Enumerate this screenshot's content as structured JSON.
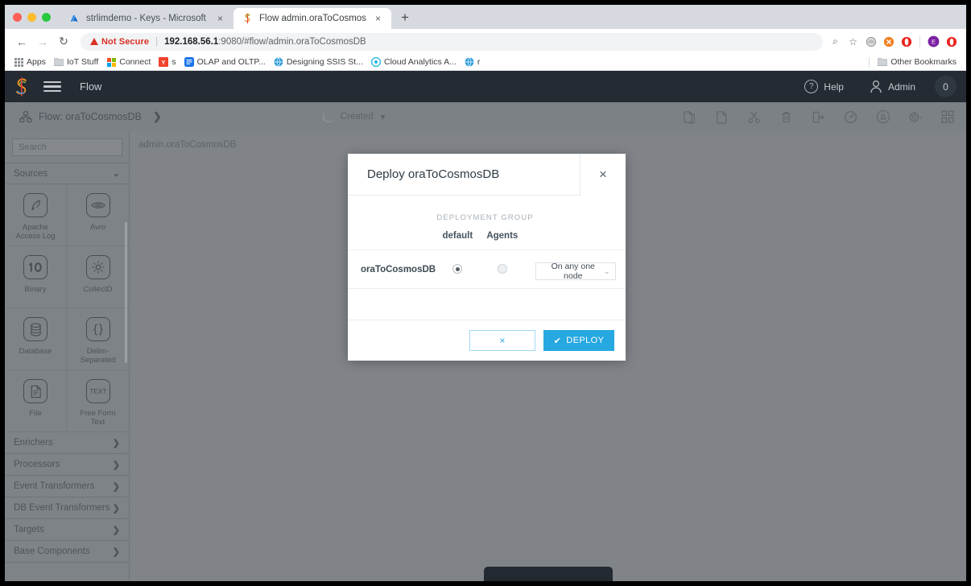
{
  "browser": {
    "tabs": [
      {
        "title": "strlimdemo - Keys - Microsoft",
        "favicon": "azure-icon",
        "close": "×",
        "active": false
      },
      {
        "title": "Flow admin.oraToCosmosDB",
        "favicon": "striim-icon",
        "close": "×",
        "active": true
      }
    ],
    "new_tab_label": "+",
    "nav": {
      "back": "←",
      "forward": "→",
      "reload": "↻"
    },
    "address": {
      "security_label": "Not Secure",
      "host": "192.168.56.1",
      "rest": ":9080/#flow/admin.oraToCosmosDB"
    },
    "omni_icons": [
      {
        "name": "zoom-icon",
        "glyph": "⌕"
      },
      {
        "name": "bookmark-star-icon",
        "glyph": "☆"
      }
    ],
    "bookmarks": [
      {
        "label": "Apps",
        "icon": "apps-grid-icon"
      },
      {
        "label": "IoT Stuff",
        "icon": "folder-icon"
      },
      {
        "label": "Connect",
        "icon": "microsoft-icon"
      },
      {
        "label": "s",
        "icon": "yahoo-icon"
      },
      {
        "label": "OLAP and OLTP...",
        "icon": "blue-doc-icon"
      },
      {
        "label": "Designing SSIS St...",
        "icon": "globe-icon"
      },
      {
        "label": "Cloud Analytics A...",
        "icon": "cyan-circle-icon"
      },
      {
        "label": "r",
        "icon": "globe-icon"
      }
    ],
    "other_bookmarks_label": "Other Bookmarks"
  },
  "app": {
    "header": {
      "logo_name": "striim-logo",
      "menu_name": "hamburger-menu",
      "section": "Flow",
      "help_label": "Help",
      "user_label": "Admin",
      "badge_count": "0"
    },
    "toolbar": {
      "breadcrumb": "Flow: oraToCosmosDB",
      "breadcrumb_chevron": "❯",
      "status": "Created",
      "status_caret": "▾",
      "icons": [
        {
          "name": "copy-icon"
        },
        {
          "name": "paste-icon"
        },
        {
          "name": "cut-icon"
        },
        {
          "name": "delete-icon"
        },
        {
          "name": "export-icon"
        },
        {
          "name": "monitor-icon"
        },
        {
          "name": "alerts-icon"
        },
        {
          "name": "settings-icon"
        },
        {
          "name": "grid-view-icon"
        }
      ]
    },
    "palette": {
      "search_placeholder": "Search",
      "sources_label": "Sources",
      "sources_caret": "⌄",
      "components": [
        {
          "label": "Apache\nAccess Log",
          "icon": "quill-icon"
        },
        {
          "label": "Avro",
          "icon": "avro-icon"
        },
        {
          "label": "Binary",
          "icon": "binary-icon"
        },
        {
          "label": "CollectD",
          "icon": "collectd-icon"
        },
        {
          "label": "Database",
          "icon": "database-icon"
        },
        {
          "label": "Delim-\nSeparated",
          "icon": "braces-icon"
        },
        {
          "label": "File",
          "icon": "file-icon"
        },
        {
          "label": "Free Form\nText",
          "icon": "text-icon"
        }
      ],
      "groups": [
        {
          "label": "Enrichers",
          "arrow": "❯"
        },
        {
          "label": "Processors",
          "arrow": "❯"
        },
        {
          "label": "Event Transformers",
          "arrow": "❯"
        },
        {
          "label": "DB Event Transformers",
          "arrow": "❯"
        },
        {
          "label": "Targets",
          "arrow": "❯"
        },
        {
          "label": "Base Components",
          "arrow": "❯"
        }
      ]
    },
    "canvas": {
      "flow_label": "admin.oraToCosmosDB"
    }
  },
  "modal": {
    "title": "Deploy oraToCosmosDB",
    "close_glyph": "×",
    "deployment_group_label": "DEPLOYMENT GROUP",
    "columns": [
      "default",
      "Agents"
    ],
    "rows": [
      {
        "name": "oraToCosmosDB",
        "default_selected": true,
        "agents_selected": false,
        "node_option": "On any one node",
        "node_caret": "⌄"
      }
    ],
    "cancel_glyph": "×",
    "deploy_check": "✔",
    "deploy_label": "DEPLOY",
    "accent_color": "#26a8e0"
  }
}
